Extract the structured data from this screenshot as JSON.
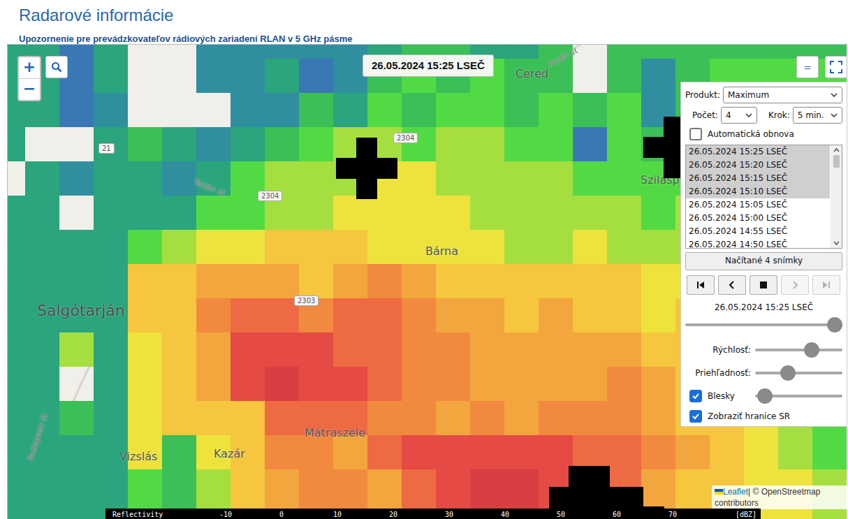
{
  "page": {
    "title": "Radarové informácie",
    "notice": "Upozornenie pre prevádzkovateľov rádiových zariadení RLAN v 5 GHz pásme"
  },
  "map": {
    "timestamp": "26.05.2024 15:25 LSEČ",
    "zoom_in": "+",
    "zoom_out": "−",
    "menu_button": "=",
    "places": [
      {
        "name": "Salgótarján",
        "kind": "town"
      },
      {
        "name": "Bárna",
        "kind": "village"
      },
      {
        "name": "Mátraszele",
        "kind": "village"
      },
      {
        "name": "Kazár",
        "kind": "village"
      },
      {
        "name": "Vizslás",
        "kind": "village"
      },
      {
        "name": "Cered",
        "kind": "village"
      },
      {
        "name": "Szilasp",
        "kind": "village"
      }
    ],
    "roads": [
      {
        "label": "21",
        "kind": "shield"
      },
      {
        "label": "2304",
        "kind": "shield"
      },
      {
        "label": "2304",
        "kind": "shield"
      },
      {
        "label": "2303",
        "kind": "shield"
      },
      {
        "label": "Tarján út",
        "kind": "street"
      },
      {
        "label": "Petőfi út",
        "kind": "street"
      },
      {
        "label": "Budapesti út",
        "kind": "street"
      }
    ],
    "lightning": [
      {
        "kind": "cross"
      },
      {
        "kind": "cross"
      },
      {
        "kind": "cluster"
      }
    ],
    "radar": {
      "dbz_rows": [
        [
          16,
          16,
          8,
          16,
          null,
          null,
          12,
          12,
          12,
          12,
          12,
          16,
          20,
          20,
          16,
          16,
          20,
          null,
          20,
          20,
          20,
          20,
          20,
          20,
          20
        ],
        [
          16,
          16,
          8,
          16,
          null,
          null,
          12,
          12,
          16,
          8,
          12,
          20,
          24,
          20,
          24,
          20,
          20,
          null,
          20,
          12,
          20,
          24,
          24,
          24,
          24
        ],
        [
          16,
          16,
          8,
          12,
          null,
          null,
          null,
          12,
          12,
          20,
          16,
          24,
          20,
          24,
          24,
          20,
          24,
          20,
          24,
          12,
          20,
          24,
          24,
          24,
          24
        ],
        [
          16,
          null,
          null,
          16,
          20,
          16,
          12,
          16,
          20,
          24,
          28,
          28,
          24,
          28,
          28,
          24,
          24,
          8,
          24,
          20,
          24,
          24,
          24,
          24,
          24
        ],
        [
          null,
          16,
          12,
          16,
          16,
          12,
          16,
          24,
          28,
          28,
          28,
          32,
          32,
          28,
          28,
          28,
          28,
          24,
          24,
          24,
          24,
          24,
          24,
          24,
          24
        ],
        [
          16,
          16,
          null,
          16,
          16,
          16,
          24,
          24,
          28,
          28,
          32,
          32,
          32,
          32,
          28,
          28,
          28,
          28,
          28,
          24,
          28,
          24,
          24,
          24,
          24
        ],
        [
          16,
          16,
          16,
          16,
          24,
          28,
          32,
          32,
          36,
          36,
          36,
          32,
          32,
          32,
          32,
          28,
          28,
          32,
          28,
          28,
          28,
          28,
          28,
          24,
          24
        ],
        [
          16,
          16,
          16,
          16,
          36,
          36,
          40,
          40,
          40,
          36,
          40,
          44,
          40,
          36,
          36,
          36,
          36,
          36,
          36,
          32,
          32,
          28,
          28,
          28,
          24
        ],
        [
          16,
          16,
          16,
          16,
          36,
          36,
          44,
          48,
          48,
          44,
          48,
          48,
          44,
          40,
          40,
          36,
          40,
          36,
          36,
          32,
          36,
          32,
          28,
          28,
          24
        ],
        [
          16,
          16,
          28,
          16,
          32,
          36,
          40,
          52,
          52,
          52,
          48,
          48,
          44,
          44,
          40,
          40,
          40,
          40,
          40,
          36,
          36,
          32,
          28,
          28,
          24
        ],
        [
          16,
          16,
          null,
          16,
          32,
          36,
          40,
          52,
          56,
          52,
          52,
          48,
          44,
          44,
          40,
          40,
          40,
          40,
          44,
          40,
          36,
          36,
          32,
          28,
          24
        ],
        [
          16,
          16,
          20,
          16,
          32,
          36,
          36,
          36,
          48,
          48,
          48,
          44,
          44,
          40,
          44,
          40,
          44,
          44,
          44,
          40,
          36,
          36,
          32,
          28,
          24
        ],
        [
          16,
          16,
          16,
          16,
          32,
          20,
          32,
          36,
          44,
          44,
          40,
          48,
          52,
          52,
          52,
          52,
          52,
          48,
          48,
          44,
          40,
          36,
          32,
          28,
          24
        ],
        [
          16,
          16,
          16,
          16,
          24,
          20,
          28,
          36,
          40,
          44,
          44,
          40,
          48,
          52,
          56,
          56,
          52,
          48,
          48,
          40,
          36,
          36,
          32,
          32,
          28
        ],
        [
          16,
          16,
          16,
          16,
          24,
          20,
          28,
          36,
          40,
          44,
          44,
          40,
          48,
          52,
          56,
          56,
          52,
          48,
          48,
          40,
          36,
          36,
          32,
          32,
          28
        ]
      ]
    },
    "attribution": {
      "link": "Leaflet",
      "text": "| © OpenStreetmap contributors"
    }
  },
  "legend": {
    "title": "Reflectivity",
    "ticks": [
      "-10",
      "0",
      "10",
      "20",
      "30",
      "40",
      "50",
      "60",
      "70"
    ],
    "unit": "[dBZ]"
  },
  "panel": {
    "product": {
      "label": "Produkt:",
      "value": "Maximum"
    },
    "count": {
      "label": "Počet:",
      "value": "4"
    },
    "step": {
      "label": "Krok:",
      "value": "5 min."
    },
    "auto_refresh": {
      "label": "Automatická obnova",
      "checked": false
    },
    "frames": [
      {
        "time": "26.05.2024 15:25 LSEČ",
        "selected": true
      },
      {
        "time": "26.05.2024 15:20 LSEČ",
        "selected": true
      },
      {
        "time": "26.05.2024 15:15 LSEČ",
        "selected": true
      },
      {
        "time": "26.05.2024 15:10 LSEČ",
        "selected": true
      },
      {
        "time": "26.05.2024 15:05 LSEČ",
        "selected": false
      },
      {
        "time": "26.05.2024 15:00 LSEČ",
        "selected": false
      },
      {
        "time": "26.05.2024 14:55 LSEČ",
        "selected": false
      },
      {
        "time": "26.05.2024 14:50 LSEČ",
        "selected": false
      }
    ],
    "load_button": "Načítané 4 snímky",
    "playback": [
      {
        "kind": "first",
        "disabled": false
      },
      {
        "kind": "prev",
        "disabled": false
      },
      {
        "kind": "stop",
        "disabled": false
      },
      {
        "kind": "next",
        "disabled": true
      },
      {
        "kind": "last",
        "disabled": true
      }
    ],
    "current_time": "26.05.2024 15:25 LSEČ",
    "time_slider": {
      "level": 1
    },
    "speed": {
      "label": "Rýchlosť:",
      "level": 0.68
    },
    "opacity": {
      "label": "Priehľadnosť:",
      "level": 0.35
    },
    "lightning": {
      "label": "Blesky",
      "checked": true,
      "level": 0.03
    },
    "borders": {
      "label": "Zobraziť hranice SR",
      "checked": true
    }
  }
}
